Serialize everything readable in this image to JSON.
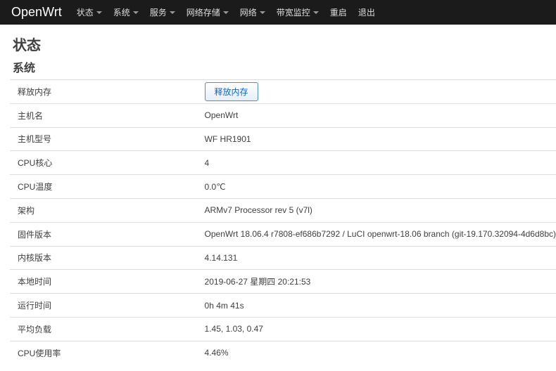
{
  "nav": {
    "brand": "OpenWrt",
    "items": [
      {
        "label": "状态",
        "dropdown": true
      },
      {
        "label": "系统",
        "dropdown": true
      },
      {
        "label": "服务",
        "dropdown": true
      },
      {
        "label": "网络存储",
        "dropdown": true
      },
      {
        "label": "网络",
        "dropdown": true
      },
      {
        "label": "带宽监控",
        "dropdown": true
      },
      {
        "label": "重启",
        "dropdown": false
      },
      {
        "label": "退出",
        "dropdown": false
      }
    ]
  },
  "page": {
    "title": "状态",
    "section": "系统"
  },
  "rows": [
    {
      "label": "释放内存",
      "button": "释放内存"
    },
    {
      "label": "主机名",
      "value": "OpenWrt"
    },
    {
      "label": "主机型号",
      "value": "WF HR1901"
    },
    {
      "label": "CPU核心",
      "value": "4"
    },
    {
      "label": "CPU温度",
      "value": "0.0℃"
    },
    {
      "label": "架构",
      "value": "ARMv7 Processor rev 5 (v7l)"
    },
    {
      "label": "固件版本",
      "value": "OpenWrt 18.06.4 r7808-ef686b7292 / LuCI openwrt-18.06 branch (git-19.170.32094-4d6d8bc)"
    },
    {
      "label": "内核版本",
      "value": "4.14.131"
    },
    {
      "label": "本地时间",
      "value": "2019-06-27 星期四 20:21:53"
    },
    {
      "label": "运行时间",
      "value": "0h 4m 41s"
    },
    {
      "label": "平均负载",
      "value": "1.45, 1.03, 0.47"
    },
    {
      "label": "CPU使用率",
      "value": "4.46%"
    }
  ]
}
